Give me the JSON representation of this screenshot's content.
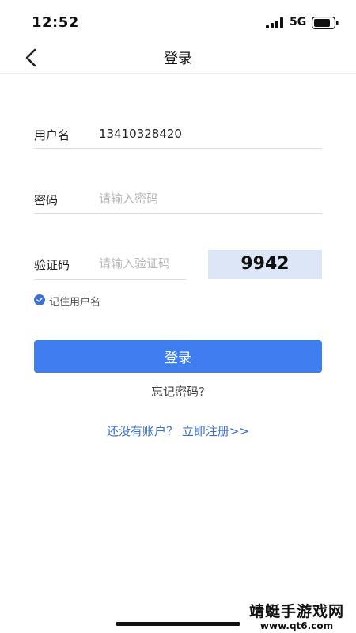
{
  "status_bar": {
    "time": "12:52",
    "network": "5G",
    "icons": [
      "signal-icon",
      "battery-icon"
    ]
  },
  "header": {
    "title": "登录",
    "back_icon": "chevron-left-icon"
  },
  "form": {
    "username": {
      "label": "用户名",
      "value": "13410328420"
    },
    "password": {
      "label": "密码",
      "placeholder": "请输入密码",
      "value": ""
    },
    "captcha": {
      "label": "验证码",
      "placeholder": "请输入验证码",
      "value": "",
      "code": "9942"
    },
    "remember": {
      "label": "记住用户名",
      "checked": true
    }
  },
  "actions": {
    "login_label": "登录",
    "forgot_label": "忘记密码?",
    "register_label": "还没有账户？ 立即注册>>"
  },
  "watermark": {
    "title": "靖蜓手游戏网",
    "url": "www.qt6.com"
  },
  "colors": {
    "primary": "#3f7ef0",
    "link": "#3b6fd4",
    "captcha_bg": "#dde6f7",
    "placeholder": "#b8b8b8"
  }
}
